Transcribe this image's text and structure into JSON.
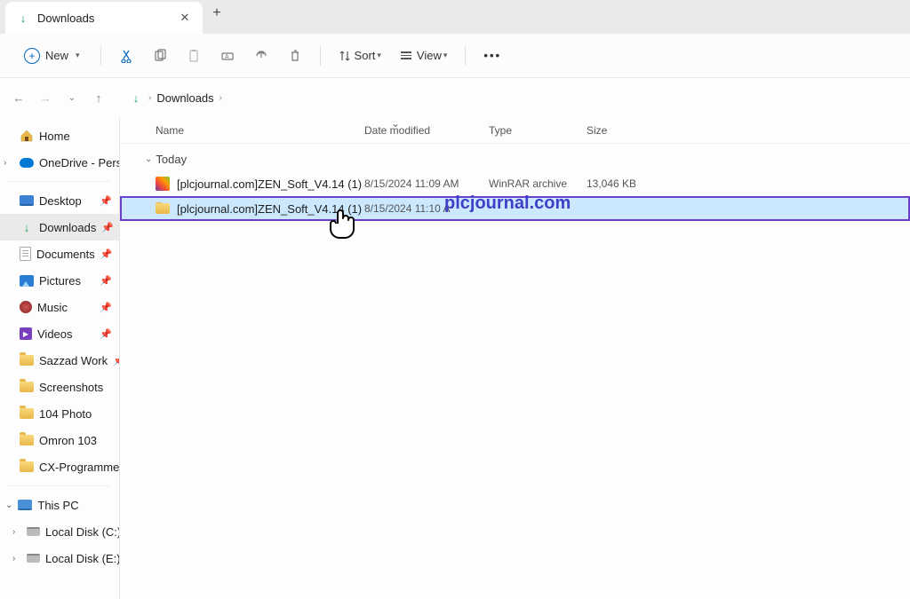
{
  "tab": {
    "title": "Downloads",
    "close_glyph": "✕",
    "add_glyph": "+"
  },
  "toolbar": {
    "new_label": "New",
    "sort_label": "Sort",
    "view_label": "View"
  },
  "breadcrumb": {
    "root": "Downloads"
  },
  "columns": {
    "name": "Name",
    "date": "Date modified",
    "type": "Type",
    "size": "Size"
  },
  "group": {
    "today": "Today"
  },
  "files": [
    {
      "name": "[plcjournal.com]ZEN_Soft_V4.14 (1)",
      "date": "8/15/2024 11:09 AM",
      "type": "WinRAR archive",
      "size": "13,046 KB"
    },
    {
      "name": "[plcjournal.com]ZEN_Soft_V4.14 (1)",
      "date": "8/15/2024 11:10 A",
      "type": "",
      "size": ""
    }
  ],
  "sidebar": {
    "home": "Home",
    "onedrive": "OneDrive - Perso",
    "quick": [
      "Desktop",
      "Downloads",
      "Documents",
      "Pictures",
      "Music",
      "Videos",
      "Sazzad Work",
      "Screenshots",
      "104 Photo",
      "Omron 103",
      "CX-Programmer"
    ],
    "thispc": "This PC",
    "drives": [
      "Local Disk (C:)",
      "Local Disk (E:)"
    ]
  },
  "watermark": "plcjournal.com"
}
